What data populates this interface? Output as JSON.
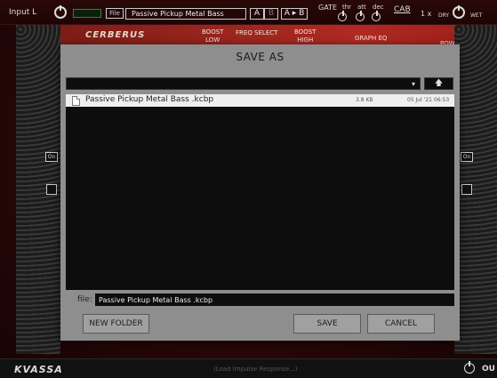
{
  "topbar": {
    "input_label": "Input L",
    "file_label": "File",
    "preset_name": "Passive Pickup Metal Bass",
    "a_label": "A",
    "b_label": "B",
    "ab_copy_label": "A ▸ B",
    "gate_label": "GATE",
    "thr_label": "thr",
    "att_label": "att",
    "dec_label": "dec",
    "cab_label": "CAB",
    "zoom_label": "1 x",
    "dry_label": "DRY",
    "wet_label": "WET"
  },
  "amp": {
    "logo": "CERBERUS",
    "boost_low": "BOOST\nLOW",
    "freq_select": "FREQ SELECT",
    "boost_high": "BOOST\nHIGH",
    "graph_eq": "GRAPH EQ",
    "power": "POWER"
  },
  "side": {
    "on_label": "On"
  },
  "bottombar": {
    "brand": "KVASSA",
    "ir_placeholder": "(Load Impulse Response...)",
    "out_label": "OU"
  },
  "dialog": {
    "title": "SAVE AS",
    "up_icon": "up-arrow-icon",
    "files": [
      {
        "name": "Passive Pickup Metal Bass .kcbp",
        "size": "3.8 KB",
        "date": "05 Jul '21 06:53"
      }
    ],
    "file_label": "file:",
    "file_value": "Passive Pickup Metal Bass .kcbp",
    "new_folder_label": "NEW FOLDER",
    "save_label": "SAVE",
    "cancel_label": "CANCEL"
  },
  "colors": {
    "dialog_bg": "#8e8e8e",
    "amp_red": "#9a261e",
    "meter_green": "#2a8a2a"
  }
}
